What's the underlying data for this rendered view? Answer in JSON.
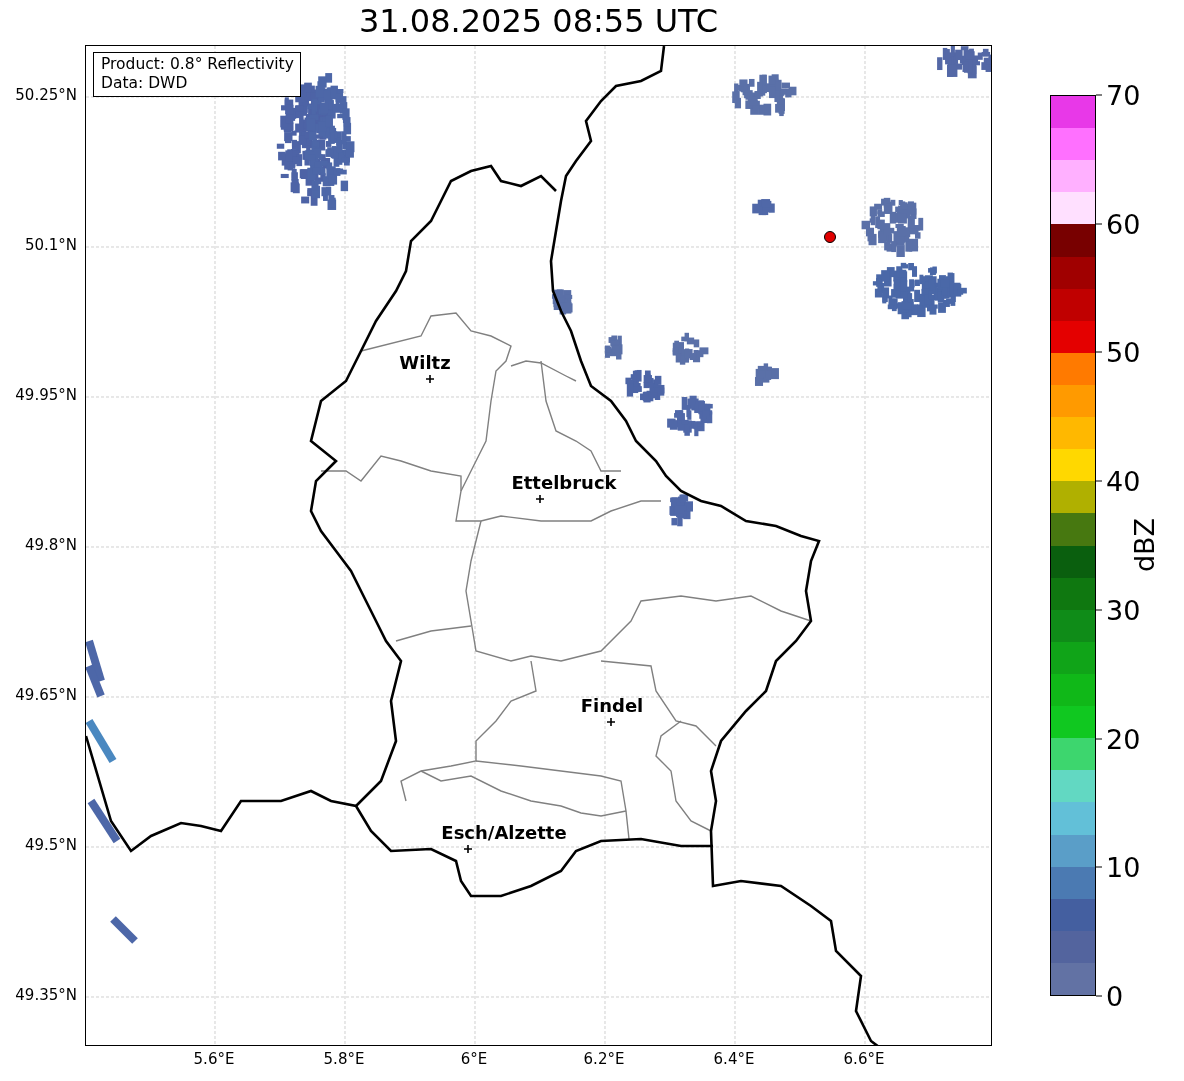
{
  "title": "31.08.2025 08:55 UTC",
  "legend": [
    "Product: 0.8° Reflectivity",
    "Data: DWD"
  ],
  "cities": [
    {
      "name": "Wiltz"
    },
    {
      "name": "Ettelbruck"
    },
    {
      "name": "Findel"
    },
    {
      "name": "Esch/Alzette"
    }
  ],
  "y_ticks": [
    "50.25°N",
    "50.1°N",
    "49.95°N",
    "49.8°N",
    "49.65°N",
    "49.5°N",
    "49.35°N"
  ],
  "x_ticks": [
    "5.6°E",
    "5.8°E",
    "6°E",
    "6.2°E",
    "6.4°E",
    "6.6°E"
  ],
  "colorbar": {
    "label": "dBZ",
    "ticks": [
      "70",
      "60",
      "50",
      "40",
      "30",
      "20",
      "10",
      "0"
    ],
    "segments": [
      {
        "color": "#e838e8"
      },
      {
        "color": "#ff70ff"
      },
      {
        "color": "#ffb0ff"
      },
      {
        "color": "#ffe0ff"
      },
      {
        "color": "#780000"
      },
      {
        "color": "#a00000"
      },
      {
        "color": "#c00000"
      },
      {
        "color": "#e40000"
      },
      {
        "color": "#ff7a00"
      },
      {
        "color": "#ff9a00"
      },
      {
        "color": "#ffb800"
      },
      {
        "color": "#ffd800"
      },
      {
        "color": "#b0b000"
      },
      {
        "color": "#477810"
      },
      {
        "color": "#0a5f0e"
      },
      {
        "color": "#0f7810"
      },
      {
        "color": "#0f8c18"
      },
      {
        "color": "#10a418"
      },
      {
        "color": "#10b818"
      },
      {
        "color": "#10c820"
      },
      {
        "color": "#3dd66e"
      },
      {
        "color": "#62d8c2"
      },
      {
        "color": "#62c0d8"
      },
      {
        "color": "#5a9ec8"
      },
      {
        "color": "#4b7ab2"
      },
      {
        "color": "#445fa0"
      },
      {
        "color": "#53649e"
      },
      {
        "color": "#6272a4"
      }
    ]
  }
}
